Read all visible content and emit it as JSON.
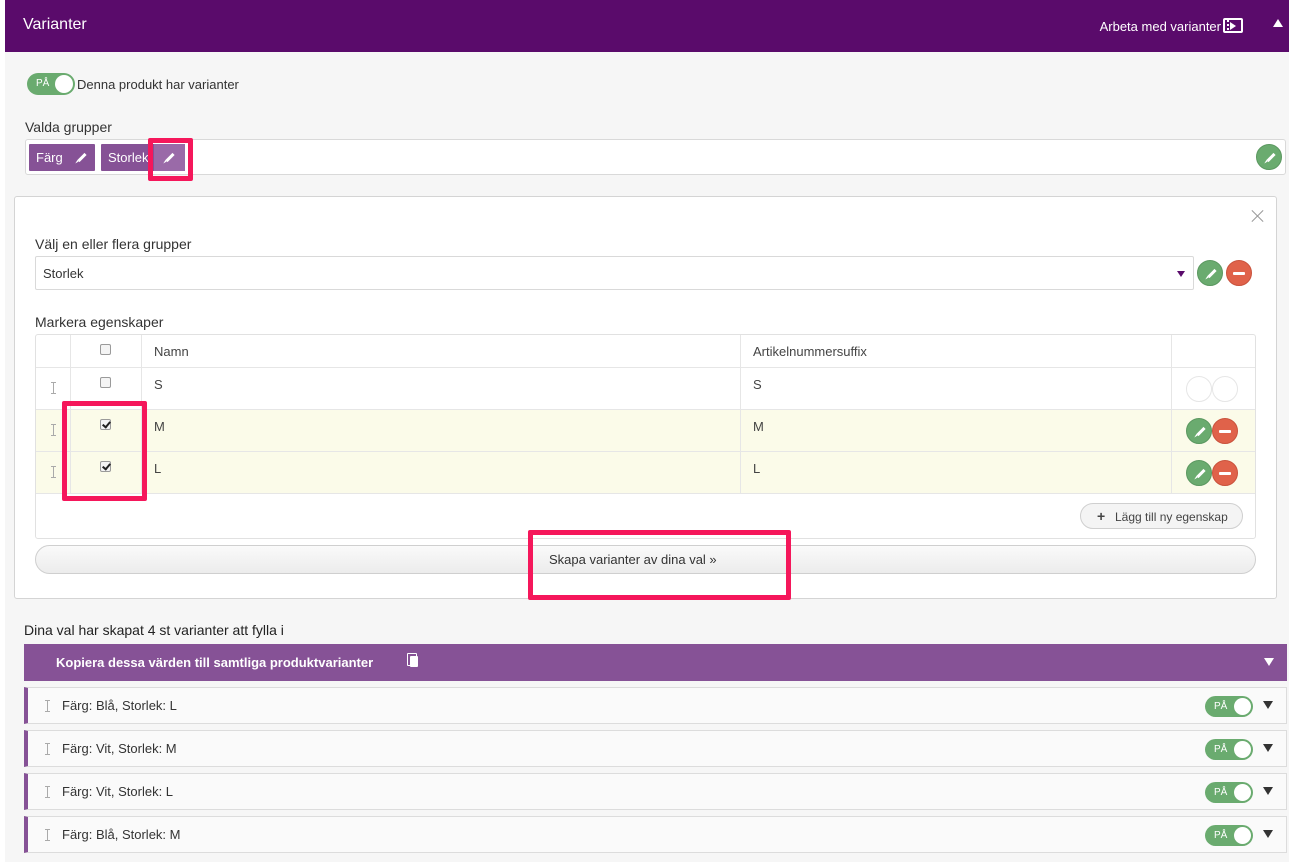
{
  "header": {
    "title": "Varianter",
    "work_label": "Arbeta med varianter"
  },
  "toggle": {
    "state_label": "PÅ",
    "description": "Denna produkt har varianter"
  },
  "groups": {
    "label": "Valda grupper",
    "chips": [
      "Färg",
      "Storlek"
    ]
  },
  "panel": {
    "select_label": "Välj en eller flera grupper",
    "select_value": "Storlek",
    "properties_label": "Markera egenskaper",
    "columns": [
      "Namn",
      "Artikelnummersuffix"
    ],
    "rows": [
      {
        "name": "S",
        "suffix": "S",
        "checked": false
      },
      {
        "name": "M",
        "suffix": "M",
        "checked": true
      },
      {
        "name": "L",
        "suffix": "L",
        "checked": true
      }
    ],
    "add_property_label": "Lägg till ny egenskap",
    "create_button_label": "Skapa varianter av dina val »"
  },
  "summary": {
    "text": "Dina val har skapat 4 st varianter att fylla i",
    "copy_label": "Kopiera dessa värden till samtliga produktvarianter"
  },
  "variants": [
    {
      "name": "Färg: Blå, Storlek: L",
      "state_label": "PÅ"
    },
    {
      "name": "Färg: Vit, Storlek: M",
      "state_label": "PÅ"
    },
    {
      "name": "Färg: Vit, Storlek: L",
      "state_label": "PÅ"
    },
    {
      "name": "Färg: Blå, Storlek: M",
      "state_label": "PÅ"
    }
  ],
  "colors": {
    "header_bg": "#5a0b6b",
    "accent_purple": "#865296",
    "toggle_green": "#6aab6f",
    "remove_red": "#e0624a",
    "highlight": "#f5175b",
    "selected_row": "#fbfbe9"
  },
  "icons": [
    "film-icon",
    "collapse-arrow-icon",
    "pencil-icon",
    "minus-icon",
    "close-icon",
    "drag-handle-icon",
    "plus-icon",
    "copy-icon",
    "chevron-down-icon"
  ]
}
